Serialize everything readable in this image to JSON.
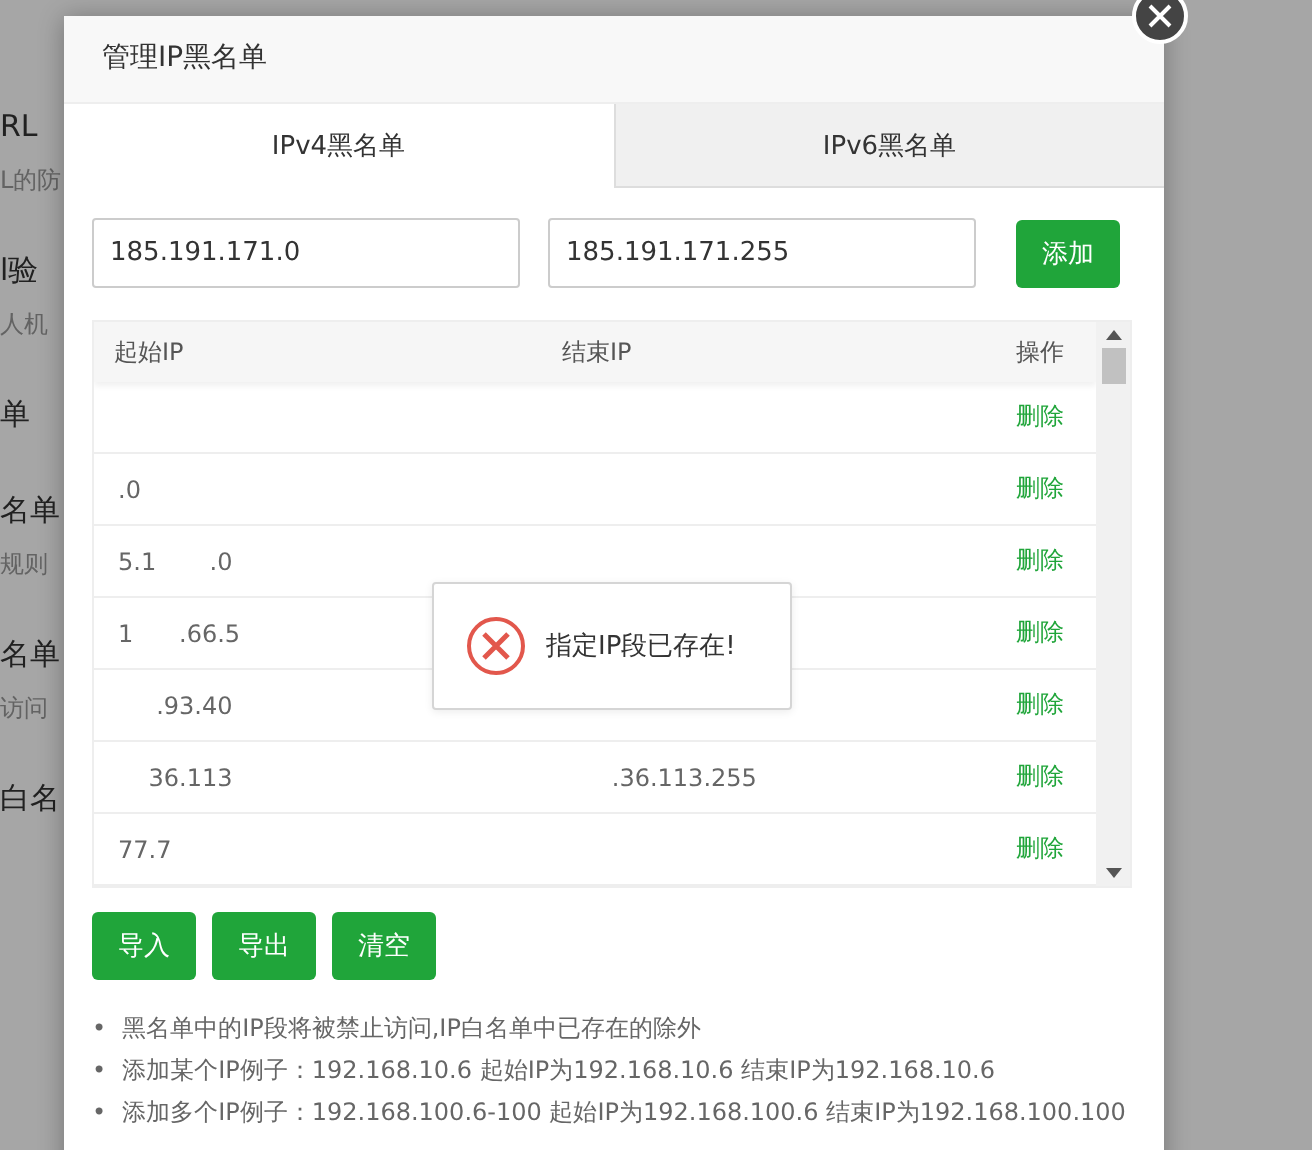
{
  "background": {
    "items": [
      {
        "kind": "title",
        "text": "RL"
      },
      {
        "kind": "desc",
        "text": "L的防"
      },
      {
        "kind": "title",
        "text": "l验"
      },
      {
        "kind": "desc",
        "text": "人机"
      },
      {
        "kind": "title",
        "text": "单"
      },
      {
        "kind": "title",
        "text": "名单"
      },
      {
        "kind": "desc",
        "text": "规则"
      },
      {
        "kind": "title",
        "text": "名单"
      },
      {
        "kind": "desc",
        "text": "访问"
      },
      {
        "kind": "title",
        "text": "白名"
      }
    ]
  },
  "dialog": {
    "title": "管理IP黑名单",
    "tabs": [
      {
        "label": "IPv4黑名单",
        "selected": true
      },
      {
        "label": "IPv6黑名单",
        "selected": false
      }
    ],
    "start_field": {
      "value": "185.191.171.0"
    },
    "end_field": {
      "value": "185.191.171.255"
    },
    "add_button": "添加",
    "table": {
      "columns": [
        "起始IP",
        "结束IP",
        "操作"
      ],
      "rows": [
        {
          "start": "",
          "end": "",
          "action": "删除"
        },
        {
          "start": ".0",
          "end": "",
          "action": "删除"
        },
        {
          "start": "5.1       .0",
          "end": "",
          "action": "删除"
        },
        {
          "start": "1      .66.5",
          "end": "",
          "action": "删除"
        },
        {
          "start": "     .93.40",
          "end": "",
          "action": "删除"
        },
        {
          "start": "    36.113",
          "end": "      .36.113.255",
          "action": "删除"
        },
        {
          "start": "77.7",
          "end": "",
          "action": "删除"
        }
      ]
    },
    "buttons": [
      "导入",
      "导出",
      "清空"
    ],
    "notes": [
      {
        "marker": "•",
        "text": "黑名单中的IP段将被禁止访问,IP白名单中已存在的除外"
      },
      {
        "marker": "•",
        "text": "添加某个IP例子：192.168.10.6 起始IP为192.168.10.6 结束IP为192.168.10.6"
      },
      {
        "marker": "•",
        "text": "添加多个IP例子：192.168.100.6-100 起始IP为192.168.100.6 结束IP为192.168.100.100"
      }
    ],
    "toast": {
      "kind": "error",
      "message": "指定IP段已存在!"
    }
  }
}
